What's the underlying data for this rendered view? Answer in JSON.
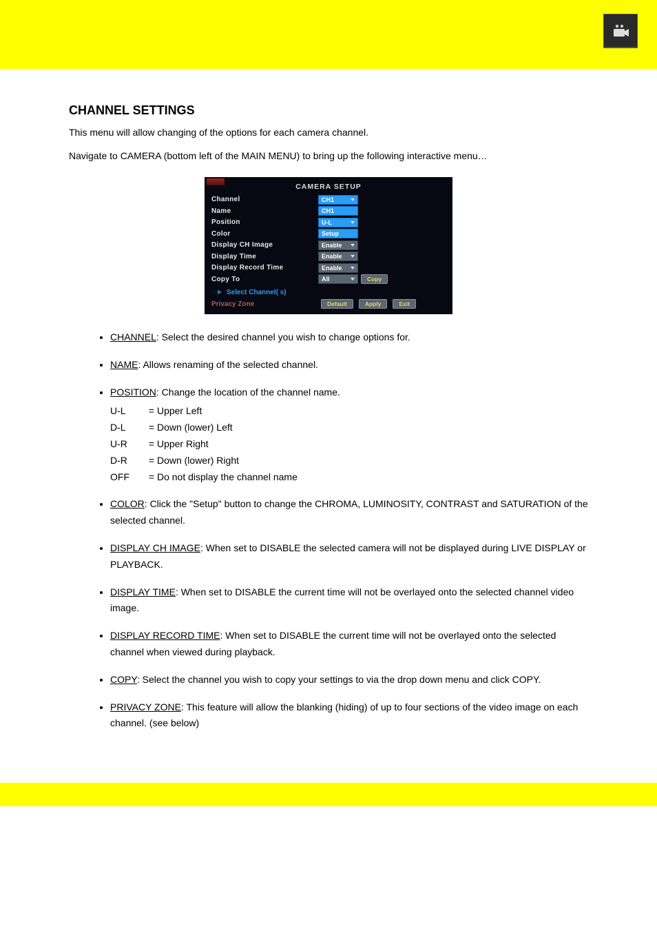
{
  "header": {
    "cam_icon_name": "video-camera-icon"
  },
  "section": {
    "heading": "CHANNEL SETTINGS",
    "intro1": "This menu will allow changing of the options for each camera channel.",
    "intro2": "Navigate to CAMERA (bottom left of the MAIN MENU) to bring up the following interactive menu…"
  },
  "screenshot": {
    "title": "CAMERA  SETUP",
    "rows": {
      "channel": {
        "label": "Channel",
        "value": "CH1",
        "type": "dd"
      },
      "name": {
        "label": "Name",
        "value": "CH1",
        "type": "text"
      },
      "position": {
        "label": "Position",
        "value": "U-L",
        "type": "dd"
      },
      "color": {
        "label": "Color",
        "value": "Setup",
        "type": "btn"
      },
      "displayCh": {
        "label": "Display  CH  Image",
        "value": "Enable",
        "type": "dd"
      },
      "displayTime": {
        "label": "Display  Time",
        "value": "Enable",
        "type": "dd"
      },
      "displayRec": {
        "label": "Display  Record  Time",
        "value": "Enable",
        "type": "dd"
      },
      "copyTo": {
        "label": "Copy  To",
        "value": "All",
        "type": "dd",
        "extra": "Copy"
      }
    },
    "selectChannels": "Select  Channel( s)",
    "privacyZone": "Privacy  Zone",
    "footerButtons": [
      "Default",
      "Apply",
      "Exit"
    ]
  },
  "bullets": [
    {
      "head": "CHANNEL",
      "body": ": Select the desired channel you wish to change options for.",
      "sub": []
    },
    {
      "head": "NAME",
      "body": ": Allows renaming of the selected channel.",
      "sub": []
    },
    {
      "head": "POSITION",
      "body": ": Change the location of the channel name.",
      "sub": [
        {
          "k": "U-L",
          "v": "= Upper Left"
        },
        {
          "k": "D-L",
          "v": "= Down (lower) Left"
        },
        {
          "k": "U-R",
          "v": "= Upper Right"
        },
        {
          "k": "D-R",
          "v": "= Down (lower) Right"
        },
        {
          "k": "OFF",
          "v": "= Do not display the channel name"
        }
      ]
    },
    {
      "head": "COLOR",
      "body": ": Click the \"Setup\" button to change the CHROMA, LUMINOSITY, CONTRAST and SATURATION of the selected channel.",
      "sub": []
    },
    {
      "head": "DISPLAY CH IMAGE",
      "body": ": When set to DISABLE the selected camera will not be displayed during LIVE DISPLAY or PLAYBACK.",
      "sub": []
    },
    {
      "head": "DISPLAY TIME",
      "body": ": When set to DISABLE the current time will not be overlayed onto the selected channel video image.",
      "sub": []
    },
    {
      "head": "DISPLAY RECORD TIME",
      "body": ": When set to DISABLE the current time will not be overlayed onto the selected channel when viewed during playback.",
      "sub": []
    },
    {
      "head": "COPY",
      "body": ": Select the channel you wish to copy your settings to via the drop down menu and click COPY.",
      "sub": []
    },
    {
      "head": "PRIVACY ZONE",
      "body": ": This feature will allow the blanking (hiding) of up to four sections of the video image on each channel. (see below)",
      "sub": []
    }
  ]
}
